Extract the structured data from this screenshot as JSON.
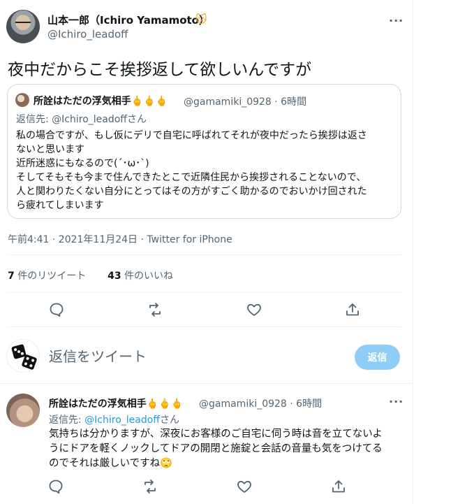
{
  "main_tweet": {
    "author_name": "山本一郎（Ichiro Yamamoto）",
    "author_emoji": "🐱",
    "author_handle": "@Ichiro_leadoff",
    "more": "···",
    "text": "夜中だからこそ挨拶返して欲しいんですが",
    "timestamp": "午前4:41 · 2021年11月24日 · Twitter for iPhone",
    "retweet_count": "7",
    "retweet_label": " 件のリツイート",
    "like_count": "43",
    "like_label": " 件のいいね"
  },
  "quoted_tweet": {
    "author_name": "所詮はただの浮気相手🖕🖕🖕",
    "handle_time": "@gamamiki_0928 · 6時間",
    "reply_to": "返信先: @Ichiro_leadoffさん",
    "lines": [
      "私の場合ですが、もし仮にデリで自宅に呼ばれてそれが夜中だったら挨拶は返さ",
      "ないと思います",
      "近所迷惑にもなるので(´･ω･`)",
      "そしてそもそも今まで住んできたとこで近隣住民から挨拶されることないので、",
      "人と関わりたくない自分にとってはその方がすごく助かるのでおいかけ回された",
      "ら疲れてしまいます"
    ]
  },
  "reply_box": {
    "placeholder": "返信をツイート",
    "button": "返信"
  },
  "reply_tweet": {
    "author_name": "所詮はただの浮気相手🖕🖕🖕",
    "handle_time": "@gamamiki_0928 · 6時間",
    "reply_prefix": "返信先: ",
    "reply_link": "@Ichiro_leadoff",
    "reply_suffix": "さん",
    "more": "···",
    "lines": [
      "気持ちは分かりますが、深夜にお客様のご自宅に伺う時は音を立てないよ",
      "うにドアを軽くノックしてドアの開閉と施錠と会話の音量も気をつけてる",
      "のでそれは厳しいですね🙄"
    ]
  },
  "icons": [
    "comment-icon",
    "retweet-icon",
    "heart-icon",
    "share-icon",
    "more-icon",
    "dice-icon"
  ],
  "colors": {
    "accent": "#1d9bf0",
    "button_disabled": "#8ecdf7",
    "muted": "#536471",
    "border": "#cfd9de"
  }
}
